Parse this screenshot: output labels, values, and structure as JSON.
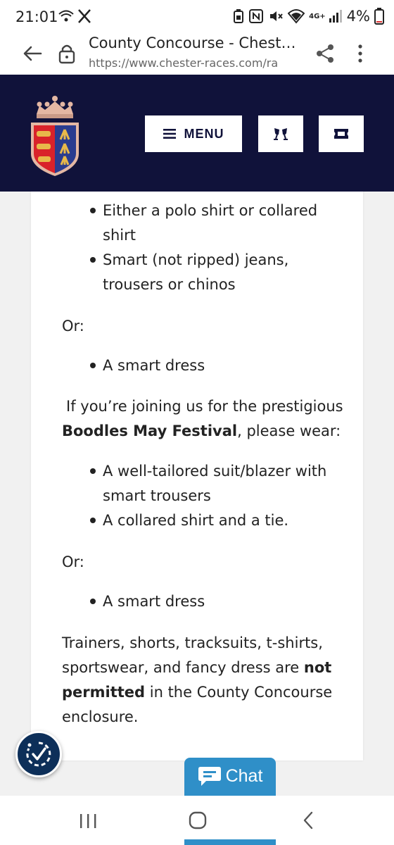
{
  "status_bar": {
    "time": "21:01",
    "battery_percent": "4%",
    "network": "4G+",
    "icons": [
      "wifi-calling-icon",
      "x-app-icon",
      "battery-saver-icon",
      "nfc-icon",
      "mute-icon",
      "wifi-icon",
      "signal-icon",
      "battery-icon"
    ]
  },
  "browser": {
    "page_title": "County Concourse - Chester Races",
    "url": "https://www.chester-races.com/ra",
    "icons": [
      "back-arrow-icon",
      "lock-icon",
      "share-icon",
      "more-vert-icon"
    ]
  },
  "site_header": {
    "background": "#10123a",
    "menu_label": "MENU",
    "icons": [
      "crest-logo",
      "hamburger-icon",
      "drinks-icon",
      "ticket-icon"
    ]
  },
  "content": {
    "list1": [
      "Either a polo shirt or collared",
      "shirt",
      "Smart (not ripped) jeans,",
      "trousers or chinos"
    ],
    "or1": "Or:",
    "dress1": "A smart dress",
    "para1": {
      "line1": "If you’re joining us for the prestigious",
      "bold": "Boodles May Festival",
      "after": ", please wear:"
    },
    "list2": [
      "A well-tailored suit/blazer with",
      "smart trousers",
      "A collared shirt and a tie."
    ],
    "or2": "Or:",
    "dress2": "A smart dress",
    "para2": {
      "line1": "Trainers, shorts, tracksuits, t-shirts,",
      "line2_pre": "sportswear, and fancy dress are ",
      "line2_bold": "not",
      "line3_bold": "permitted",
      "line3_post": " in the County Concourse",
      "line4": "enclosure."
    }
  },
  "widgets": {
    "chat_label": "Chat",
    "chat_color": "#2f8fc8",
    "accessibility_color": "#0d2f59"
  },
  "nav_bar": {
    "icons": [
      "recent-apps-icon",
      "home-icon",
      "back-icon"
    ]
  }
}
